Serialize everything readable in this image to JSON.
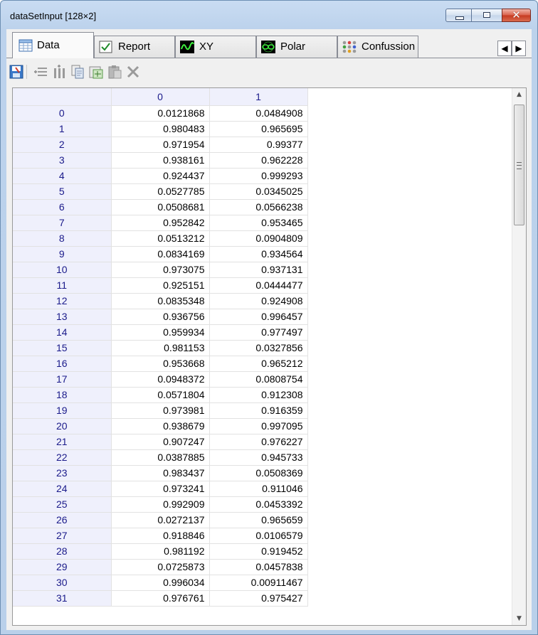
{
  "window": {
    "title": "dataSetInput [128×2]"
  },
  "tabs": [
    {
      "label": "Data",
      "icon": "table-icon",
      "active": true
    },
    {
      "label": "Report",
      "icon": "checkbox-icon",
      "active": false
    },
    {
      "label": "XY",
      "icon": "waveform-icon",
      "active": false
    },
    {
      "label": "Polar",
      "icon": "polar-plot-icon",
      "active": false
    },
    {
      "label": "Confussion",
      "icon": "dots-matrix-icon",
      "active": false
    }
  ],
  "toolbar": {
    "buttons": [
      "save-icon",
      "insert-rows-icon",
      "insert-columns-icon",
      "copy-icon",
      "import-icon",
      "paste-icon",
      "delete-icon"
    ]
  },
  "grid": {
    "columns": [
      "0",
      "1"
    ],
    "rows": [
      [
        "0",
        "0.0121868",
        "0.0484908"
      ],
      [
        "1",
        "0.980483",
        "0.965695"
      ],
      [
        "2",
        "0.971954",
        "0.99377"
      ],
      [
        "3",
        "0.938161",
        "0.962228"
      ],
      [
        "4",
        "0.924437",
        "0.999293"
      ],
      [
        "5",
        "0.0527785",
        "0.0345025"
      ],
      [
        "6",
        "0.0508681",
        "0.0566238"
      ],
      [
        "7",
        "0.952842",
        "0.953465"
      ],
      [
        "8",
        "0.0513212",
        "0.0904809"
      ],
      [
        "9",
        "0.0834169",
        "0.934564"
      ],
      [
        "10",
        "0.973075",
        "0.937131"
      ],
      [
        "11",
        "0.925151",
        "0.0444477"
      ],
      [
        "12",
        "0.0835348",
        "0.924908"
      ],
      [
        "13",
        "0.936756",
        "0.996457"
      ],
      [
        "14",
        "0.959934",
        "0.977497"
      ],
      [
        "15",
        "0.981153",
        "0.0327856"
      ],
      [
        "16",
        "0.953668",
        "0.965212"
      ],
      [
        "17",
        "0.0948372",
        "0.0808754"
      ],
      [
        "18",
        "0.0571804",
        "0.912308"
      ],
      [
        "19",
        "0.973981",
        "0.916359"
      ],
      [
        "20",
        "0.938679",
        "0.997095"
      ],
      [
        "21",
        "0.907247",
        "0.976227"
      ],
      [
        "22",
        "0.0387885",
        "0.945733"
      ],
      [
        "23",
        "0.983437",
        "0.0508369"
      ],
      [
        "24",
        "0.973241",
        "0.911046"
      ],
      [
        "25",
        "0.992909",
        "0.0453392"
      ],
      [
        "26",
        "0.0272137",
        "0.965659"
      ],
      [
        "27",
        "0.918846",
        "0.0106579"
      ],
      [
        "28",
        "0.981192",
        "0.919452"
      ],
      [
        "29",
        "0.0725873",
        "0.0457838"
      ],
      [
        "30",
        "0.996034",
        "0.00911467"
      ],
      [
        "31",
        "0.976761",
        "0.975427"
      ]
    ]
  },
  "colors": {
    "header_bg": "#eff0fc",
    "header_text": "#1a1a8a",
    "close_red": "#c6391f"
  }
}
